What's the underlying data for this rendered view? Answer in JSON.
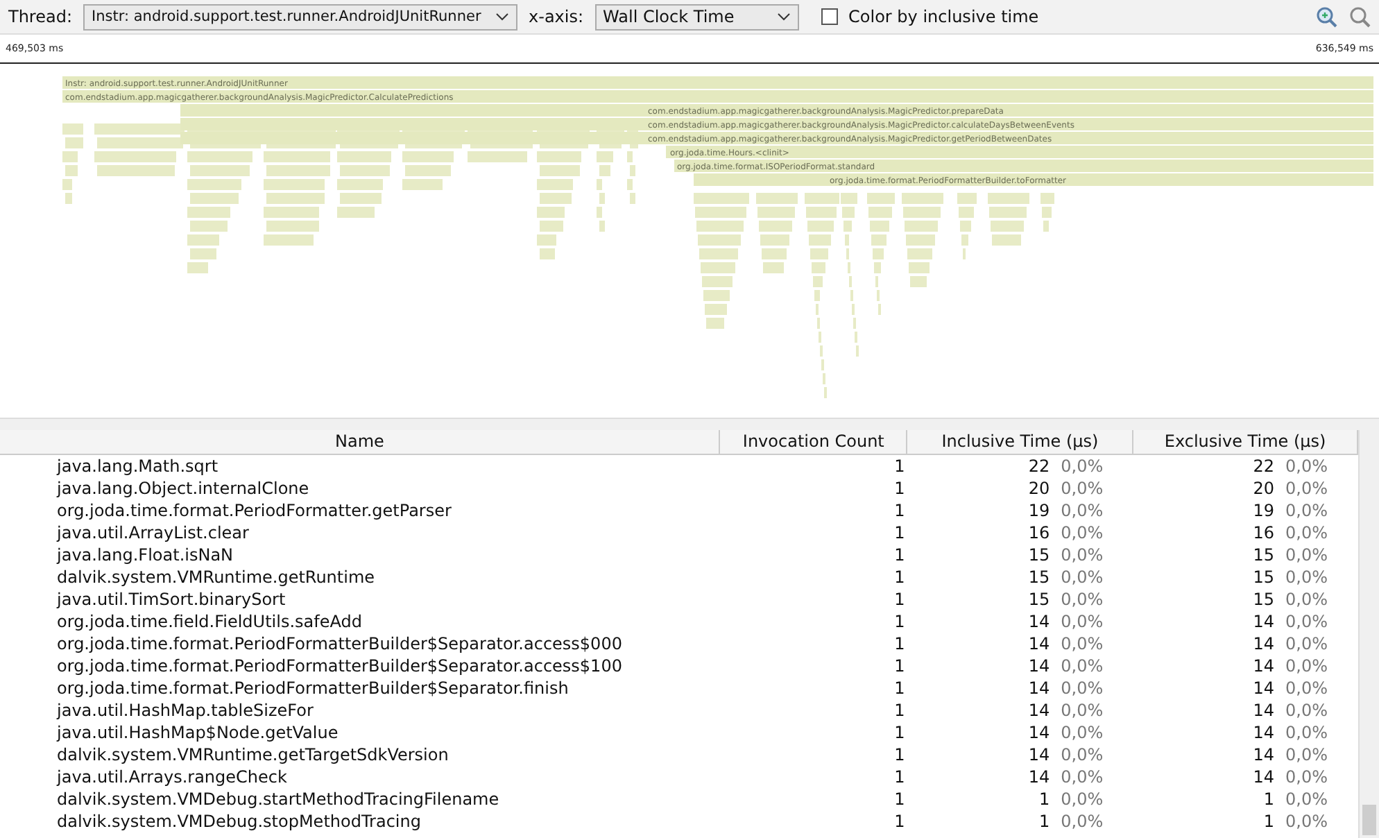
{
  "toolbar": {
    "thread_label": "Thread:",
    "thread_value": "Instr: android.support.test.runner.AndroidJUnitRunner",
    "xaxis_label": "x-axis:",
    "xaxis_value": "Wall Clock Time",
    "color_by_inclusive": {
      "label": "Color by inclusive time",
      "checked": false
    }
  },
  "timeline": {
    "start": "469,503 ms",
    "end": "636,549 ms"
  },
  "flame_chart": {
    "frames": [
      {
        "label": "Instr: android.support.test.runner.AndroidJUnitRunner"
      },
      {
        "label": "com.endstadium.app.magicgatherer.backgroundAnalysis.MagicPredictor.CalculatePredictions"
      },
      {
        "label": "com.endstadium.app.magicgatherer.backgroundAnalysis.MagicPredictor.prepareData"
      },
      {
        "label": "com.endstadium.app.magicgatherer.backgroundAnalysis.MagicPredictor.calculateDaysBetweenEvents"
      },
      {
        "label": "com.endstadium.app.magicgatherer.backgroundAnalysis.MagicPredictor.getPeriodBetweenDates"
      },
      {
        "label": "org.joda.time.Hours.<clinit>"
      },
      {
        "label": "org.joda.time.format.ISOPeriodFormat.standard"
      },
      {
        "label": "org.joda.time.format.PeriodFormatterBuilder.toFormatter"
      }
    ]
  },
  "table": {
    "columns": [
      "Name",
      "Invocation Count",
      "Inclusive Time (µs)",
      "Exclusive Time (µs)"
    ],
    "rows": [
      {
        "name": "java.lang.Math.sqrt",
        "count": "1",
        "inclusive": "22",
        "inclusive_pct": "0,0%",
        "exclusive": "22",
        "exclusive_pct": "0,0%"
      },
      {
        "name": "java.lang.Object.internalClone",
        "count": "1",
        "inclusive": "20",
        "inclusive_pct": "0,0%",
        "exclusive": "20",
        "exclusive_pct": "0,0%"
      },
      {
        "name": "org.joda.time.format.PeriodFormatter.getParser",
        "count": "1",
        "inclusive": "19",
        "inclusive_pct": "0,0%",
        "exclusive": "19",
        "exclusive_pct": "0,0%"
      },
      {
        "name": "java.util.ArrayList.clear",
        "count": "1",
        "inclusive": "16",
        "inclusive_pct": "0,0%",
        "exclusive": "16",
        "exclusive_pct": "0,0%"
      },
      {
        "name": "java.lang.Float.isNaN",
        "count": "1",
        "inclusive": "15",
        "inclusive_pct": "0,0%",
        "exclusive": "15",
        "exclusive_pct": "0,0%"
      },
      {
        "name": "dalvik.system.VMRuntime.getRuntime",
        "count": "1",
        "inclusive": "15",
        "inclusive_pct": "0,0%",
        "exclusive": "15",
        "exclusive_pct": "0,0%"
      },
      {
        "name": "java.util.TimSort.binarySort",
        "count": "1",
        "inclusive": "15",
        "inclusive_pct": "0,0%",
        "exclusive": "15",
        "exclusive_pct": "0,0%"
      },
      {
        "name": "org.joda.time.field.FieldUtils.safeAdd",
        "count": "1",
        "inclusive": "14",
        "inclusive_pct": "0,0%",
        "exclusive": "14",
        "exclusive_pct": "0,0%"
      },
      {
        "name": "org.joda.time.format.PeriodFormatterBuilder$Separator.access$000",
        "count": "1",
        "inclusive": "14",
        "inclusive_pct": "0,0%",
        "exclusive": "14",
        "exclusive_pct": "0,0%"
      },
      {
        "name": "org.joda.time.format.PeriodFormatterBuilder$Separator.access$100",
        "count": "1",
        "inclusive": "14",
        "inclusive_pct": "0,0%",
        "exclusive": "14",
        "exclusive_pct": "0,0%"
      },
      {
        "name": "org.joda.time.format.PeriodFormatterBuilder$Separator.finish",
        "count": "1",
        "inclusive": "14",
        "inclusive_pct": "0,0%",
        "exclusive": "14",
        "exclusive_pct": "0,0%"
      },
      {
        "name": "java.util.HashMap.tableSizeFor",
        "count": "1",
        "inclusive": "14",
        "inclusive_pct": "0,0%",
        "exclusive": "14",
        "exclusive_pct": "0,0%"
      },
      {
        "name": "java.util.HashMap$Node.getValue",
        "count": "1",
        "inclusive": "14",
        "inclusive_pct": "0,0%",
        "exclusive": "14",
        "exclusive_pct": "0,0%"
      },
      {
        "name": "dalvik.system.VMRuntime.getTargetSdkVersion",
        "count": "1",
        "inclusive": "14",
        "inclusive_pct": "0,0%",
        "exclusive": "14",
        "exclusive_pct": "0,0%"
      },
      {
        "name": "java.util.Arrays.rangeCheck",
        "count": "1",
        "inclusive": "14",
        "inclusive_pct": "0,0%",
        "exclusive": "14",
        "exclusive_pct": "0,0%"
      },
      {
        "name": "dalvik.system.VMDebug.startMethodTracingFilename",
        "count": "1",
        "inclusive": "1",
        "inclusive_pct": "0,0%",
        "exclusive": "1",
        "exclusive_pct": "0,0%"
      },
      {
        "name": "dalvik.system.VMDebug.stopMethodTracing",
        "count": "1",
        "inclusive": "1",
        "inclusive_pct": "0,0%",
        "exclusive": "1",
        "exclusive_pct": "0,0%"
      }
    ]
  }
}
